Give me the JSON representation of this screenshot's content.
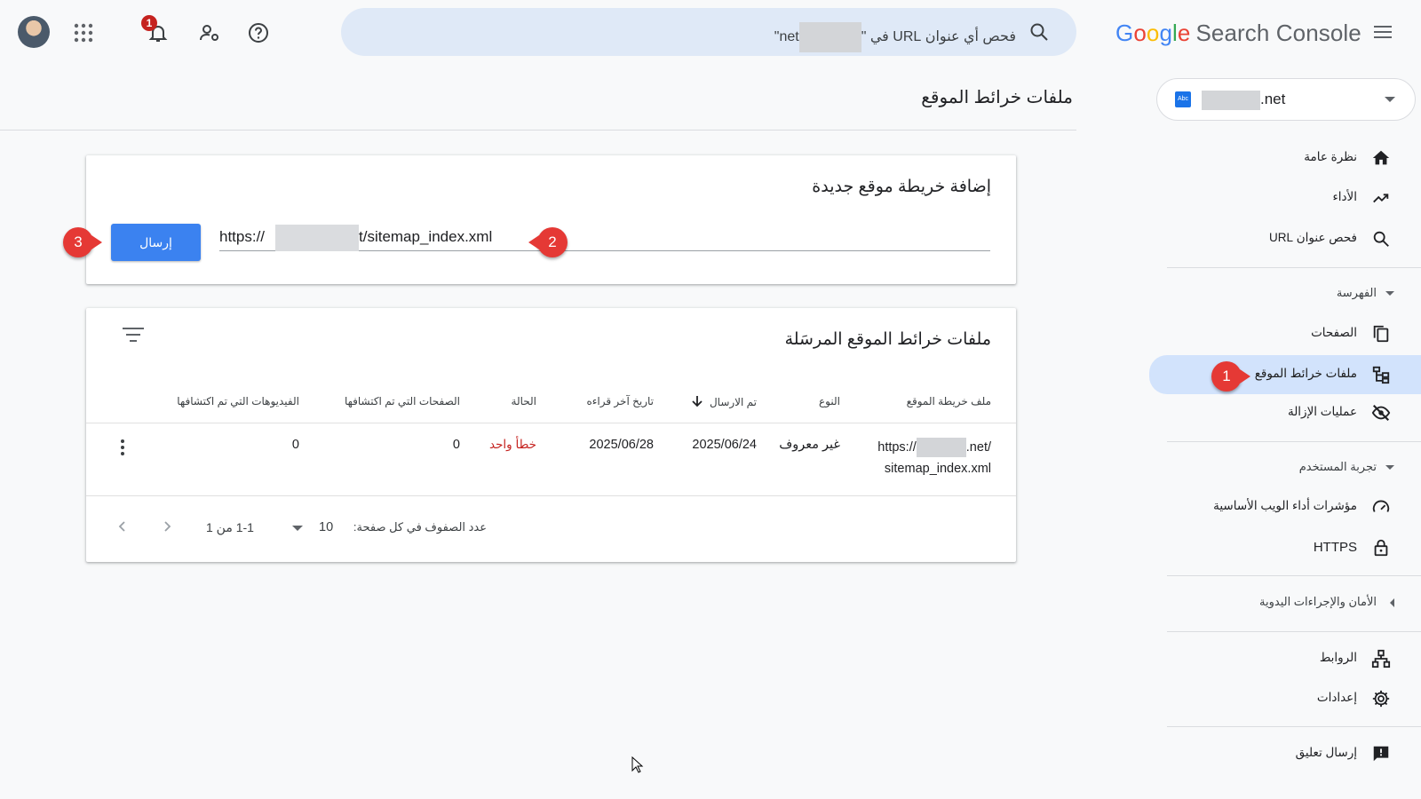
{
  "app": {
    "logo_google": [
      "G",
      "o",
      "o",
      "g",
      "l",
      "e"
    ],
    "logo_product": "Search Console"
  },
  "search": {
    "placeholder_prefix": "فحص أي عنوان URL في \"",
    "placeholder_suffix": "net",
    "placeholder_end": "\""
  },
  "topbar": {
    "notification_count": "1"
  },
  "page": {
    "title": "ملفات خرائط الموقع"
  },
  "property": {
    "favicon_text": "Abc",
    "domain_suffix": ".net"
  },
  "sidebar": {
    "items": [
      {
        "label": "نظرة عامة",
        "icon": "home-icon"
      },
      {
        "label": "الأداء",
        "icon": "trending-up-icon"
      },
      {
        "label": "فحص عنوان URL",
        "icon": "search-icon"
      },
      {
        "label": "الصفحات",
        "icon": "pages-icon"
      },
      {
        "label": "ملفات خرائط الموقع",
        "icon": "sitemap-icon"
      },
      {
        "label": "عمليات الإزالة",
        "icon": "eye-off-icon"
      },
      {
        "label": "مؤشرات أداء الويب الأساسية",
        "icon": "speed-icon"
      },
      {
        "label": "HTTPS",
        "icon": "lock-icon"
      },
      {
        "label": "الروابط",
        "icon": "links-icon"
      },
      {
        "label": "إعدادات",
        "icon": "gear-icon"
      },
      {
        "label": "إرسال تعليق",
        "icon": "feedback-icon"
      }
    ],
    "sections": {
      "indexing": "الفهرسة",
      "experience": "تجربة المستخدم",
      "security": "الأمان والإجراءات اليدوية"
    }
  },
  "add_sitemap": {
    "title": "إضافة خريطة موقع جديدة",
    "url_prefix": "https://",
    "url_suffix": "t/sitemap_index.xml",
    "submit_label": "إرسال"
  },
  "submitted": {
    "title": "ملفات خرائط الموقع المرسَلة",
    "columns": {
      "sitemap": "ملف خريطة الموقع",
      "type": "النوع",
      "submitted": "تم الارسال",
      "last_read": "تاريخ آخر قراءه",
      "status": "الحالة",
      "pages": "الصفحات التي تم اكتشافها",
      "videos": "الفيديوهات التي تم اكتشافها"
    },
    "rows": [
      {
        "sitemap_prefix": "https://",
        "sitemap_domain_suffix": ".net/",
        "sitemap_path": "sitemap_index.xml",
        "type": "غير معروف",
        "submitted": "2025/06/24",
        "last_read": "2025/06/28",
        "status": "خطأ واحد",
        "pages": "0",
        "videos": "0"
      }
    ],
    "pager": {
      "rows_per_page_label": "عدد الصفوف في كل صفحة:",
      "rows_per_page": "10",
      "range": "1-1 من 1"
    }
  },
  "annotations": [
    "1",
    "2",
    "3"
  ],
  "colors": {
    "accent": "#1a73e8",
    "submit": "#3b82f0",
    "active_nav": "#d2e3fc",
    "error": "#c5221f",
    "step_marker": "#e53935"
  }
}
